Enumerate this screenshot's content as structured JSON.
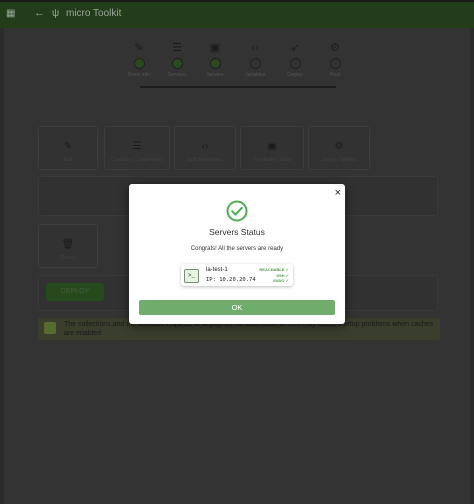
{
  "header": {
    "title": "micro Toolkit",
    "left_icon": "grid-icon"
  },
  "stepper": {
    "steps": [
      {
        "icon": "pencil-icon",
        "label": "Basic info"
      },
      {
        "icon": "list-icon",
        "label": "Services"
      },
      {
        "icon": "server-icon",
        "label": "Servers"
      },
      {
        "icon": "code-icon",
        "label": "Variables"
      },
      {
        "icon": "rocket-icon",
        "label": "Deploy"
      },
      {
        "icon": "wrench-icon",
        "label": "Post"
      }
    ]
  },
  "background_cards": [
    {
      "icon": "pencil-icon",
      "label": "Edit"
    },
    {
      "icon": "list-icon",
      "label": "Configure Components"
    },
    {
      "icon": "code-icon",
      "label": "Edit Inventories"
    },
    {
      "icon": "server-icon",
      "label": "Pre-deploy Steps"
    },
    {
      "icon": "wrench-icon",
      "label": "Deploy Options"
    }
  ],
  "background_card2": {
    "icon": "trash-icon",
    "label": "Delete"
  },
  "background_button": "DEPLOY",
  "alert": {
    "text": "The collections and the software required to deploy will be downloaded. This may cause startup problems when caches are enabled."
  },
  "modal": {
    "title": "Servers Status",
    "message": "Congrats! All the servers are ready",
    "server": {
      "name": "la-test-1",
      "ip_label": "IP: 10.20.20.74",
      "statuses": [
        "REACHABLE ✓",
        "SSH ✓",
        "SUDO ✓"
      ]
    },
    "ok_label": "OK",
    "close_label": "×"
  },
  "colors": {
    "accent": "#70ad6c",
    "topbar": "#233c1a",
    "check": "#4caf50"
  }
}
